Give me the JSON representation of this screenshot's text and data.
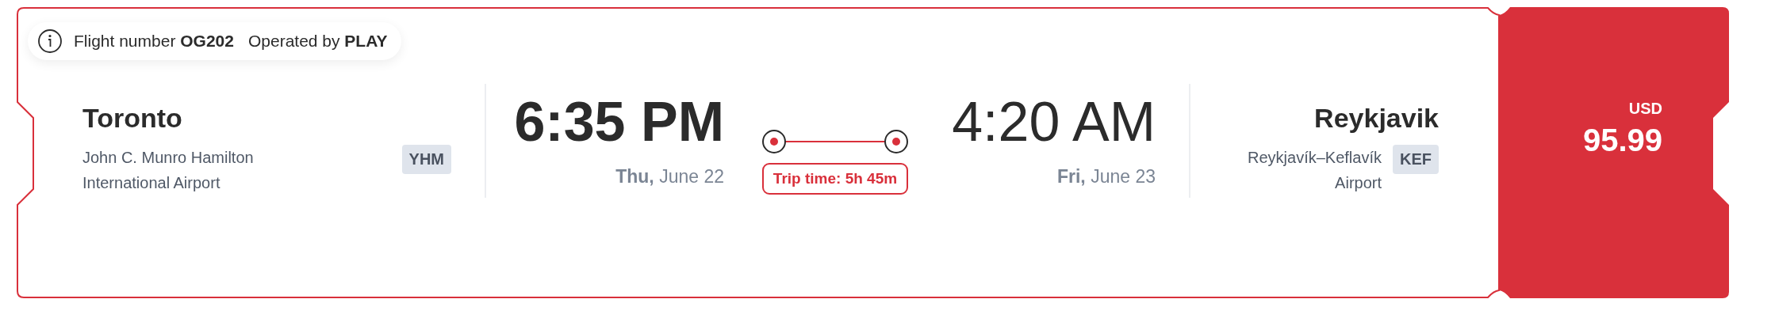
{
  "flight_info": {
    "flight_number": "Flight number **OG202**",
    "operator": "Operated by **PLAY**"
  },
  "departure": {
    "city": "Toronto",
    "airport": "John C. Munro Hamilton International Airport",
    "code": "YHM",
    "time": "6:35 PM",
    "date": "**Thu,** June 22"
  },
  "trip": {
    "duration": "Trip time: 5h 45m"
  },
  "arrival": {
    "city": "Reykjavik",
    "airport": "Reykjavík–Keflavík Airport",
    "code": "KEF",
    "time": "4:20 AM",
    "date": "**Fri,** June 23"
  },
  "price": {
    "currency": "USD",
    "amount": "95.99"
  }
}
